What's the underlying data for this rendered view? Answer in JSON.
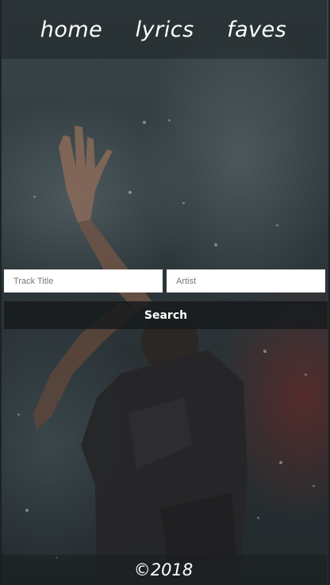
{
  "nav": {
    "items": [
      {
        "label": "home"
      },
      {
        "label": "lyrics"
      },
      {
        "label": "faves"
      }
    ]
  },
  "search": {
    "track_placeholder": "Track Title",
    "artist_placeholder": "Artist",
    "button_label": "Search"
  },
  "footer": {
    "copyright": "©2018"
  }
}
